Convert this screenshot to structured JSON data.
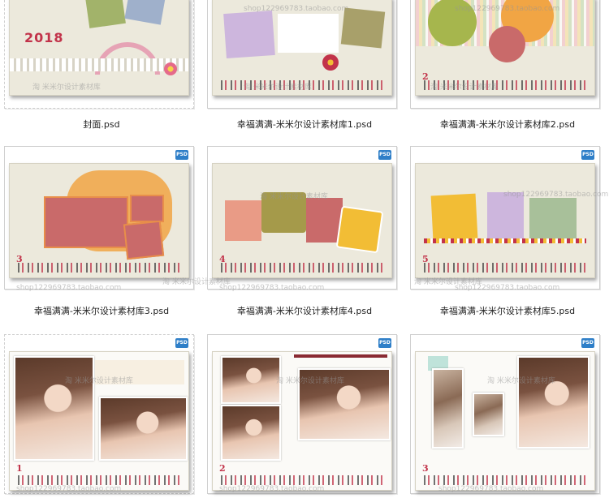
{
  "watermark": {
    "cn": "淘 米米尔设计素材库",
    "url": "shop122969783.taobao.com"
  },
  "badge_label": "PSD",
  "thumbnails": [
    {
      "caption": "封面.psd",
      "year": "2018"
    },
    {
      "caption": "幸福满满-米米尔设计素材库1.psd"
    },
    {
      "caption": "幸福满满-米米尔设计素材库2.psd"
    },
    {
      "caption": "幸福满满-米米尔设计素材库3.psd",
      "month": "3"
    },
    {
      "caption": "幸福满满-米米尔设计素材库4.psd",
      "month": "4"
    },
    {
      "caption": "幸福满满-米米尔设计素材库5.psd",
      "month": "5"
    },
    {
      "caption": "",
      "month": "1"
    },
    {
      "caption": "",
      "month": "2"
    },
    {
      "caption": "",
      "month": "3"
    }
  ],
  "colors": {
    "paper": "#ece9dc",
    "accent_red": "#c2334a",
    "olive": "#a89a56",
    "lavender": "#cdb6dd",
    "salmon": "#e99b86",
    "orange": "#f1a544",
    "yellow": "#f2bd35",
    "sage": "#a8c09a",
    "rose": "#c96a6a"
  }
}
